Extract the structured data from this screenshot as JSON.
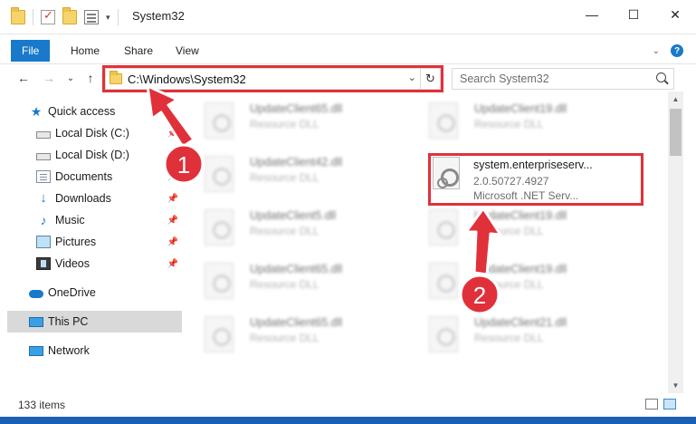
{
  "window": {
    "title": "System32",
    "controls": {
      "minimize": "—",
      "maximize": "☐",
      "close": "✕"
    }
  },
  "ribbon": {
    "tabs": [
      "File",
      "Home",
      "Share",
      "View"
    ],
    "expand_glyph": "⌄",
    "help_glyph": "?"
  },
  "nav": {
    "back": "←",
    "forward": "→",
    "recent": "⌄",
    "up": "↑",
    "address": "C:\\Windows\\System32",
    "address_dropdown": "⌄",
    "refresh": "↻",
    "search_placeholder": "Search System32"
  },
  "sidebar": {
    "items": [
      {
        "label": "Quick access",
        "icon": "star-icon",
        "pinned": false
      },
      {
        "label": "Local Disk (C:)",
        "icon": "disk-icon",
        "pinned": true
      },
      {
        "label": "Local Disk (D:)",
        "icon": "disk-icon",
        "pinned": false
      },
      {
        "label": "Documents",
        "icon": "documents-icon",
        "pinned": true
      },
      {
        "label": "Downloads",
        "icon": "downloads-icon",
        "pinned": true
      },
      {
        "label": "Music",
        "icon": "music-icon",
        "pinned": true
      },
      {
        "label": "Pictures",
        "icon": "pictures-icon",
        "pinned": true
      },
      {
        "label": "Videos",
        "icon": "videos-icon",
        "pinned": true
      },
      {
        "label": "OneDrive",
        "icon": "onedrive-icon",
        "pinned": false
      },
      {
        "label": "This PC",
        "icon": "this-pc-icon",
        "pinned": false,
        "selected": true
      },
      {
        "label": "Network",
        "icon": "network-icon",
        "pinned": false
      }
    ],
    "pin_glyph": "📌"
  },
  "files": {
    "left_column": [
      {
        "name": "UpdateClient65.dll",
        "type": "Resource DLL"
      },
      {
        "name": "UpdateClient42.dll",
        "type": "Resource DLL"
      },
      {
        "name": "UpdateClient5.dll",
        "type": "Resource DLL"
      },
      {
        "name": "UpdateClient65.dll",
        "type": "Resource DLL"
      },
      {
        "name": "UpdateClient65.dll",
        "type": "Resource DLL"
      }
    ],
    "right_column": [
      {
        "name": "UpdateClient19.dll",
        "type": "Resource DLL"
      },
      {
        "name": "UpdateClient19.dll",
        "type": "Resource DLL"
      },
      {
        "name": "UpdateClient19.dll",
        "type": "Resource DLL"
      },
      {
        "name": "UpdateClient21.dll",
        "type": "Resource DLL"
      }
    ],
    "highlighted": {
      "name": "system.enterpriseserv...",
      "version": "2.0.50727.4927",
      "company": "Microsoft .NET Serv..."
    }
  },
  "status": {
    "item_count": "133 items"
  },
  "annotations": {
    "step1": "1",
    "step2": "2",
    "color": "#e0313a"
  }
}
